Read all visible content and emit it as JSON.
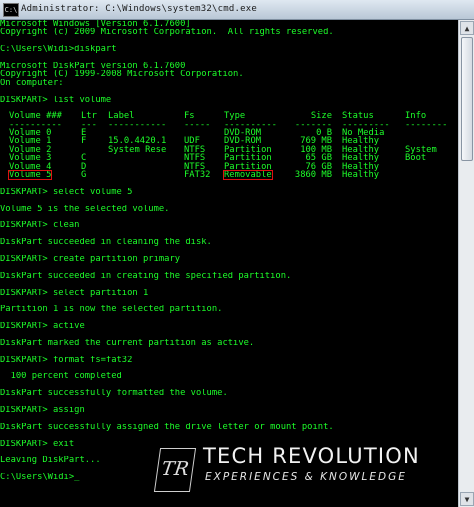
{
  "window": {
    "title": "Administrator: C:\\Windows\\system32\\cmd.exe",
    "icon": "console-icon"
  },
  "lines_top": [
    "Microsoft Windows [Version 6.1.7600]",
    "Copyright (c) 2009 Microsoft Corporation.  All rights reserved.",
    "",
    "C:\\Users\\Widi>diskpart",
    "",
    "Microsoft DiskPart version 6.1.7600",
    "Copyright (C) 1999-2008 Microsoft Corporation.",
    "On computer:",
    "",
    "DISKPART> list volume",
    ""
  ],
  "volume_table": {
    "headers": [
      "Volume ###",
      "Ltr",
      "Label",
      "Fs",
      "Type",
      "Size",
      "Status",
      "Info"
    ],
    "separators": [
      "----------",
      "---",
      "-----------",
      "-----",
      "----------",
      "-------",
      "---------",
      "--------"
    ],
    "rows": [
      [
        "Volume 0",
        "E",
        "",
        "",
        "DVD-ROM",
        "0 B",
        "No Media",
        ""
      ],
      [
        "Volume 1",
        "F",
        "15.0.4420.1",
        "UDF",
        "DVD-ROM",
        "769 MB",
        "Healthy",
        ""
      ],
      [
        "Volume 2",
        "",
        "System Rese",
        "NTFS",
        "Partition",
        "100 MB",
        "Healthy",
        "System"
      ],
      [
        "Volume 3",
        "C",
        "",
        "NTFS",
        "Partition",
        "65 GB",
        "Healthy",
        "Boot"
      ],
      [
        "Volume 4",
        "D",
        "",
        "NTFS",
        "Partition",
        "76 GB",
        "Healthy",
        ""
      ],
      [
        "Volume 5",
        "G",
        "",
        "FAT32",
        "Removable",
        "3860 MB",
        "Healthy",
        ""
      ]
    ]
  },
  "lines_bottom": [
    "",
    "DISKPART> select volume 5",
    "",
    "Volume 5 is the selected volume.",
    "",
    "DISKPART> clean",
    "",
    "DiskPart succeeded in cleaning the disk.",
    "",
    "DISKPART> create partition primary",
    "",
    "DiskPart succeeded in creating the specified partition.",
    "",
    "DISKPART> select partition 1",
    "",
    "Partition 1 is now the selected partition.",
    "",
    "DISKPART> active",
    "",
    "DiskPart marked the current partition as active.",
    "",
    "DISKPART> format fs=fat32",
    "",
    "  100 percent completed",
    "",
    "DiskPart successfully formatted the volume.",
    "",
    "DISKPART> assign",
    "",
    "DiskPart successfully assigned the drive letter or mount point.",
    "",
    "DISKPART> exit",
    "",
    "Leaving DiskPart...",
    "",
    "C:\\Users\\Widi>_"
  ],
  "logo": {
    "mark": "TR",
    "title": "TECH REVOLUTION",
    "subtitle": "EXPERIENCES & KNOWLEDGE"
  },
  "colors": {
    "text": "#1dff2a",
    "background": "#000000",
    "highlight": "#d11111"
  }
}
